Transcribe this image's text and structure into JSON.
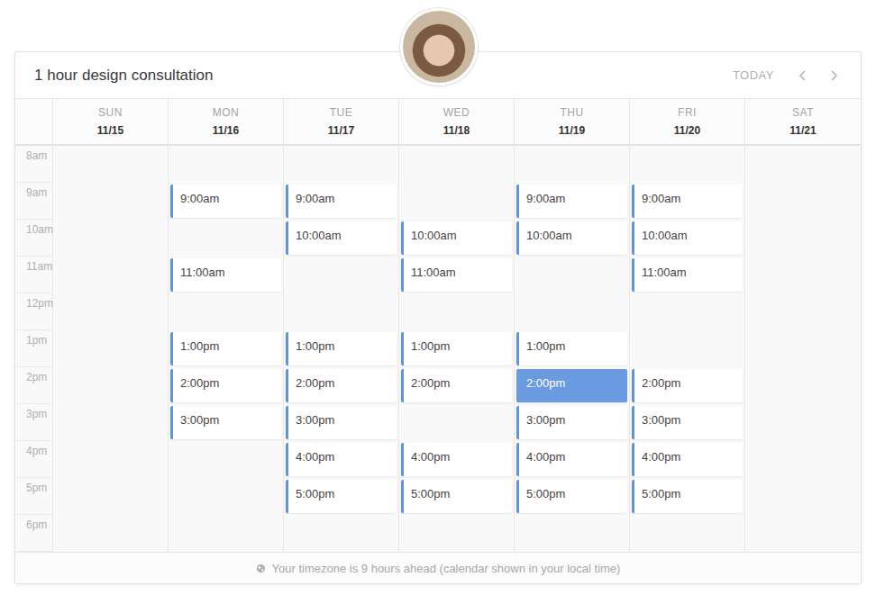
{
  "event": {
    "title": "1 hour design consultation"
  },
  "nav": {
    "today": "TODAY"
  },
  "hours": [
    "8am",
    "9am",
    "10am",
    "11am",
    "12pm",
    "1pm",
    "2pm",
    "3pm",
    "4pm",
    "5pm",
    "6pm"
  ],
  "days": [
    {
      "name": "SUN",
      "date": "11/15",
      "slots": []
    },
    {
      "name": "MON",
      "date": "11/16",
      "slots": [
        {
          "time": "9:00am",
          "selected": false
        },
        {
          "time": "11:00am",
          "selected": false
        },
        {
          "time": "1:00pm",
          "selected": false
        },
        {
          "time": "2:00pm",
          "selected": false
        },
        {
          "time": "3:00pm",
          "selected": false
        }
      ]
    },
    {
      "name": "TUE",
      "date": "11/17",
      "slots": [
        {
          "time": "9:00am",
          "selected": false
        },
        {
          "time": "10:00am",
          "selected": false
        },
        {
          "time": "1:00pm",
          "selected": false
        },
        {
          "time": "2:00pm",
          "selected": false
        },
        {
          "time": "3:00pm",
          "selected": false
        },
        {
          "time": "4:00pm",
          "selected": false
        },
        {
          "time": "5:00pm",
          "selected": false
        }
      ]
    },
    {
      "name": "WED",
      "date": "11/18",
      "slots": [
        {
          "time": "10:00am",
          "selected": false
        },
        {
          "time": "11:00am",
          "selected": false
        },
        {
          "time": "1:00pm",
          "selected": false
        },
        {
          "time": "2:00pm",
          "selected": false
        },
        {
          "time": "4:00pm",
          "selected": false
        },
        {
          "time": "5:00pm",
          "selected": false
        }
      ]
    },
    {
      "name": "THU",
      "date": "11/19",
      "slots": [
        {
          "time": "9:00am",
          "selected": false
        },
        {
          "time": "10:00am",
          "selected": false
        },
        {
          "time": "1:00pm",
          "selected": false
        },
        {
          "time": "2:00pm",
          "selected": true
        },
        {
          "time": "3:00pm",
          "selected": false
        },
        {
          "time": "4:00pm",
          "selected": false
        },
        {
          "time": "5:00pm",
          "selected": false
        }
      ]
    },
    {
      "name": "FRI",
      "date": "11/20",
      "slots": [
        {
          "time": "9:00am",
          "selected": false
        },
        {
          "time": "10:00am",
          "selected": false
        },
        {
          "time": "11:00am",
          "selected": false
        },
        {
          "time": "2:00pm",
          "selected": false
        },
        {
          "time": "3:00pm",
          "selected": false
        },
        {
          "time": "4:00pm",
          "selected": false
        },
        {
          "time": "5:00pm",
          "selected": false
        }
      ]
    },
    {
      "name": "SAT",
      "date": "11/21",
      "slots": []
    }
  ],
  "footer": {
    "text": "Your timezone is 9 hours ahead (calendar shown in your local time)"
  }
}
